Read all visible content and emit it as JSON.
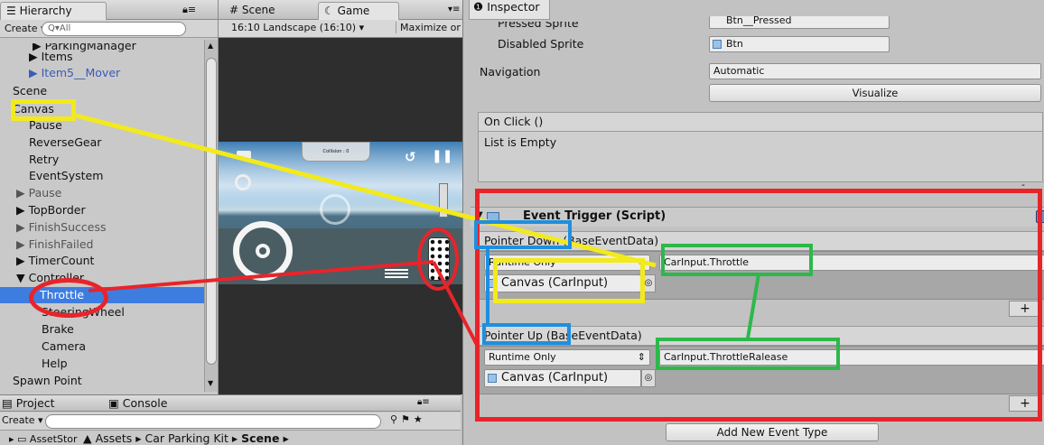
{
  "hierarchy": {
    "tab": "Hierarchy",
    "create": "Create",
    "search_placeholder": "Q▾All",
    "items": [
      {
        "label": "ParkingManager",
        "prefix": "▶ "
      },
      {
        "label": "Items",
        "prefix": "▶ "
      },
      {
        "label": "Item5__Mover",
        "prefix": "▶ "
      },
      {
        "label": "Scene",
        "prefix": ""
      },
      {
        "label": "Canvas",
        "prefix": ""
      },
      {
        "label": "Pause",
        "prefix": ""
      },
      {
        "label": "ReverseGear",
        "prefix": ""
      },
      {
        "label": "Retry",
        "prefix": ""
      },
      {
        "label": "EventSystem",
        "prefix": ""
      },
      {
        "label": "Pause",
        "prefix": "▶ "
      },
      {
        "label": "TopBorder",
        "prefix": "▶ "
      },
      {
        "label": "FinishSuccess",
        "prefix": "▶ "
      },
      {
        "label": "FinishFailed",
        "prefix": "▶ "
      },
      {
        "label": "TimerCount",
        "prefix": "▶ "
      },
      {
        "label": "Controller",
        "prefix": "▼ "
      },
      {
        "label": "Throttle",
        "prefix": ""
      },
      {
        "label": "SteeringWheel",
        "prefix": ""
      },
      {
        "label": "Brake",
        "prefix": ""
      },
      {
        "label": "Camera",
        "prefix": ""
      },
      {
        "label": "Help",
        "prefix": ""
      },
      {
        "label": "Spawn Point",
        "prefix": ""
      }
    ]
  },
  "game": {
    "tab_scene": "Scene",
    "tab_game": "Game",
    "aspect": "16:10 Landscape (16:10)",
    "maximize": "Maximize on Play",
    "collision_label": "Collision : 0"
  },
  "project": {
    "tab_project": "Project",
    "tab_console": "Console",
    "create": "Create",
    "folder": "AssetStor",
    "breadcrumb_1": "Assets",
    "breadcrumb_2": "Car Parking Kit",
    "breadcrumb_3": "Scene",
    "sep": "▸"
  },
  "inspector": {
    "tab": "Inspector",
    "pressed_sprite_label": "Pressed Sprite",
    "pressed_sprite_value": "Btn__Pressed",
    "disabled_sprite_label": "Disabled Sprite",
    "disabled_sprite_value": "Btn",
    "navigation_label": "Navigation",
    "navigation_value": "Automatic",
    "visualize": "Visualize",
    "onclick_header": "On Click ()",
    "onclick_empty": "List is Empty",
    "component_title": "Event Trigger (Script)",
    "event1_header": "Pointer Down (BaseEventData)",
    "event1_mode": "Runtime Only",
    "event1_target": "Canvas (CarInput)",
    "event1_function": "CarInput.Throttle",
    "event2_header": "Pointer Up (BaseEventData)",
    "event2_mode": "Runtime Only",
    "event2_target": "Canvas (CarInput)",
    "event2_function": "CarInput.ThrottleRalease",
    "plus": "+",
    "minus": "-",
    "add_event": "Add New Event Type"
  },
  "colors": {
    "yellow": "#f2ea1c",
    "red": "#e8242a",
    "blue": "#1e8fe0",
    "green": "#2db84a",
    "selection": "#3e7de0"
  }
}
